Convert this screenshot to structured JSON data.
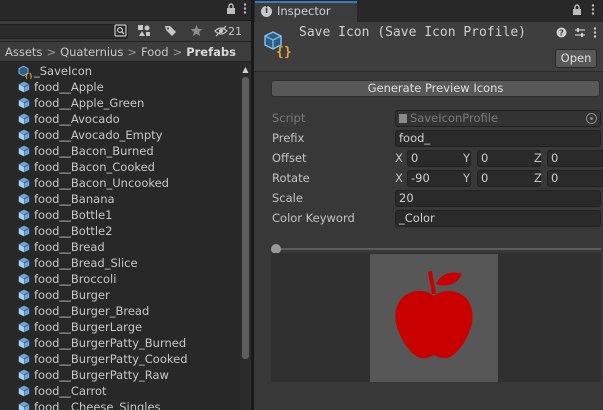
{
  "project": {
    "tab_badge": "21",
    "breadcrumb": [
      {
        "label": "Assets",
        "current": false
      },
      {
        "label": "Quaternius",
        "current": false
      },
      {
        "label": "Food",
        "current": false
      },
      {
        "label": "Prefabs",
        "current": true
      }
    ],
    "items": [
      "_SaveIcon",
      "food__Apple",
      "food__Apple_Green",
      "food__Avocado",
      "food__Avocado_Empty",
      "food__Bacon_Burned",
      "food__Bacon_Cooked",
      "food__Bacon_Uncooked",
      "food__Banana",
      "food__Bottle1",
      "food__Bottle2",
      "food__Bread",
      "food__Bread_Slice",
      "food__Broccoli",
      "food__Burger",
      "food__Burger_Bread",
      "food__BurgerLarge",
      "food__BurgerPatty_Burned",
      "food__BurgerPatty_Cooked",
      "food__BurgerPatty_Raw",
      "food__Carrot",
      "food__Cheese_Singles"
    ]
  },
  "inspector": {
    "tab_label": "Inspector",
    "title": "Save Icon (Save Icon Profile)",
    "open_label": "Open",
    "generate_label": "Generate Preview Icons",
    "script": {
      "label": "Script",
      "value": "SaveIconProfile"
    },
    "prefix": {
      "label": "Prefix",
      "value": "food_"
    },
    "offset": {
      "label": "Offset",
      "x": "0",
      "y": "0",
      "z": "0"
    },
    "rotate": {
      "label": "Rotate",
      "x": "-90",
      "y": "0",
      "z": "0"
    },
    "scale": {
      "label": "Scale",
      "value": "20"
    },
    "color_keyword": {
      "label": "Color Keyword",
      "value": "_Color"
    },
    "axis_labels": {
      "x": "X",
      "y": "Y",
      "z": "Z"
    },
    "preview_slider_level": 0,
    "preview_fruit_color": "#c80000"
  },
  "colors": {
    "accent_tab": "#3a79bb",
    "prefab_icon": "#6fa7d8",
    "apple_red": "#c80000"
  }
}
